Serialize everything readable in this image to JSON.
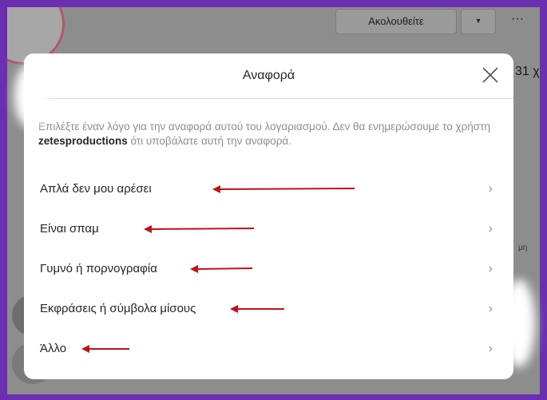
{
  "background": {
    "follow_label": "Ακολουθείτε",
    "dropdown_glyph": "▾",
    "more_glyph": "···",
    "count_text": "31 χρ",
    "side_text": "μη"
  },
  "modal": {
    "title": "Αναφορά",
    "close_icon": "close-icon",
    "description_prefix": "Επιλέξτε έναν λόγο για την αναφορά αυτού του λογαριασμού. Δεν θα ενημερώσουμε το χρήστη ",
    "username": "zetesproductions",
    "description_suffix": " ότι υποβάλατε αυτή την αναφορά.",
    "reasons": [
      {
        "label": "Απλά δεν μου αρέσει",
        "chevron": "›"
      },
      {
        "label": "Είναι σπαμ",
        "chevron": "›"
      },
      {
        "label": "Γυμνό ή πορνογραφία",
        "chevron": "›"
      },
      {
        "label": "Εκφράσεις ή σύμβολα μίσους",
        "chevron": "›"
      },
      {
        "label": "Άλλο",
        "chevron": "›"
      }
    ]
  },
  "colors": {
    "annotation_arrow": "#c0111a",
    "border_purple": "#6a2fb0",
    "backdrop": "#8d8d8d"
  }
}
